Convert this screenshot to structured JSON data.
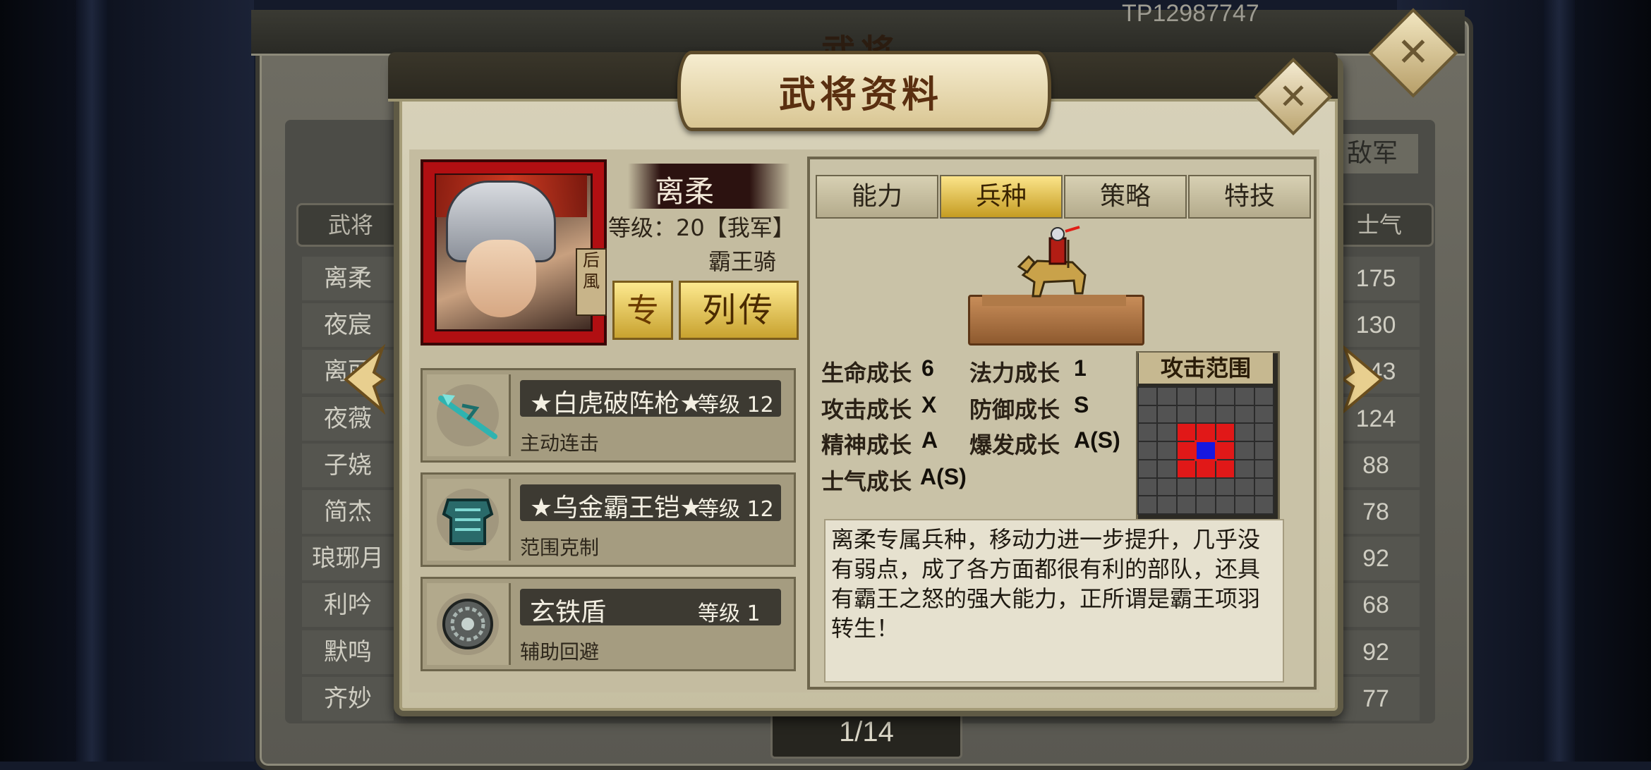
{
  "background": {
    "title": "武将",
    "player_id": "TP12987747",
    "tag": "敌军",
    "header_left": "武将",
    "header_right": "士气",
    "names": [
      "离柔",
      "夜宸",
      "离丽",
      "夜薇",
      "子娆",
      "简杰",
      "琅琊月",
      "利吟",
      "默鸣",
      "齐妙"
    ],
    "morale": [
      "175",
      "130",
      "143",
      "124",
      "88",
      "78",
      "92",
      "68",
      "92",
      "77"
    ],
    "page": "1/14"
  },
  "modal": {
    "title": "武将资料",
    "character": {
      "name": "离柔",
      "level_text": "等级：20【我军】",
      "unit_type": "霸王骑",
      "portrait_tag": "后風",
      "exclusive_label": "专",
      "biography_label": "列传"
    },
    "equipment": [
      {
        "name": "★白虎破阵枪★",
        "level": "等级 12",
        "desc": "主动连击",
        "icon": "spear-icon"
      },
      {
        "name": "★乌金霸王铠★",
        "level": "等级 12",
        "desc": "范围克制",
        "icon": "armor-icon"
      },
      {
        "name": "玄铁盾",
        "level": "等级 1",
        "desc": "辅助回避",
        "icon": "shield-icon"
      }
    ],
    "tabs": [
      {
        "label": "能力",
        "active": false
      },
      {
        "label": "兵种",
        "active": true
      },
      {
        "label": "策略",
        "active": false
      },
      {
        "label": "特技",
        "active": false
      }
    ],
    "growth": {
      "hp_label": "生命成长",
      "hp": "6",
      "mp_label": "法力成长",
      "mp": "1",
      "atk_label": "攻击成长",
      "atk": "X",
      "def_label": "防御成长",
      "def": "S",
      "spirit_label": "精神成长",
      "spirit": "A",
      "burst_label": "爆发成长",
      "burst": "A(S)",
      "morale_label": "士气成长",
      "morale": "A(S)"
    },
    "attack_range": {
      "title": "攻击范围",
      "grid_size": 7,
      "red_cells": [
        [
          2,
          2
        ],
        [
          2,
          3
        ],
        [
          2,
          4
        ],
        [
          3,
          2
        ],
        [
          3,
          4
        ],
        [
          4,
          2
        ],
        [
          4,
          3
        ],
        [
          4,
          4
        ]
      ],
      "center_cell": [
        3,
        3
      ]
    },
    "description": "离柔专属兵种，移动力进一步提升，几乎没有弱点，成了各方面都很有利的部队，还具有霸王之怒的强大能力，正所谓是霸王项羽转生！"
  },
  "colors": {
    "accent_gold": "#c59c22",
    "range_red": "#e11818",
    "range_blue": "#1717e0"
  }
}
